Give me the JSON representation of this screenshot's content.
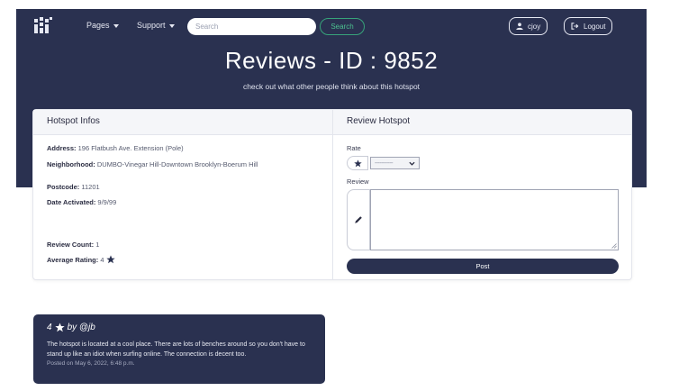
{
  "nav": {
    "pages_label": "Pages",
    "support_label": "Support",
    "search_placeholder": "Search",
    "search_button": "Search",
    "user_label": "cjoy",
    "logout_label": "Logout"
  },
  "hero": {
    "title": "Reviews - ID : 9852",
    "subtitle": "check out what other people think about this hotspot"
  },
  "hotspot": {
    "heading": "Hotspot Infos",
    "address_label": "Address:",
    "address_value": "196 Flatbush Ave. Extension (Pole)",
    "neighborhood_label": "Neighborhood:",
    "neighborhood_value": "DUMBO-Vinegar Hill-Downtown Brooklyn-Boerum Hill",
    "postcode_label": "Postcode:",
    "postcode_value": "11201",
    "date_label": "Date Activated:",
    "date_value": "9/9/99",
    "review_count_label": "Review Count:",
    "review_count_value": "1",
    "avg_rating_label": "Average Rating:",
    "avg_rating_value": "4"
  },
  "review_form": {
    "heading": "Review Hotspot",
    "rate_label": "Rate",
    "rate_placeholder": "-----------",
    "review_label": "Review",
    "post_button": "Post"
  },
  "reviews": [
    {
      "rating": "4",
      "author": "by @jb",
      "text": "The hotspot is located at a cool place. There are lots of benches around so you don't have to stand up like an idiot when surfing online. The connection is decent too.",
      "date": "Posted on May 6, 2022, 6:48 p.m."
    }
  ],
  "colors": {
    "navy": "#2a3150",
    "search_accent": "#37a37a",
    "white": "#ffffff"
  },
  "icons": {
    "logo": "wifi-grid-logo",
    "user": "user-icon",
    "logout": "logout-icon",
    "star": "star-icon",
    "pencil": "pencil-icon"
  }
}
